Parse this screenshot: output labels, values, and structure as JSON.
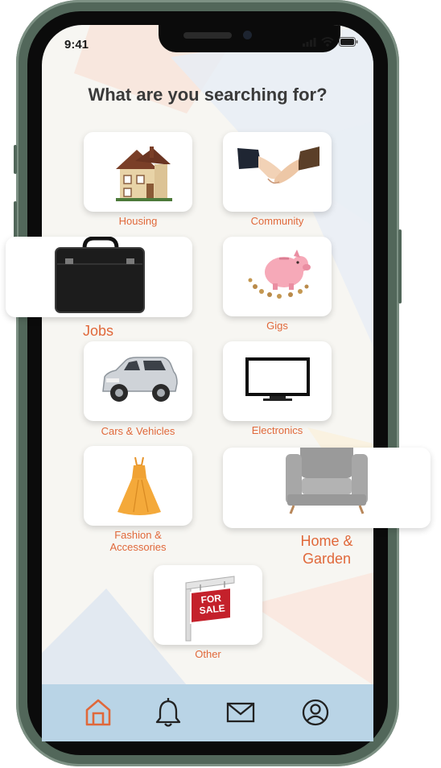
{
  "status_bar": {
    "time": "9:41"
  },
  "page": {
    "headline": "What are you searching for?"
  },
  "categories": [
    {
      "label": "Housing",
      "icon": "house-icon"
    },
    {
      "label": "Community",
      "icon": "handshake-icon"
    },
    {
      "label": "Jobs",
      "icon": "briefcase-icon"
    },
    {
      "label": "Gigs",
      "icon": "piggy-bank-icon"
    },
    {
      "label": "Cars & Vehicles",
      "icon": "car-icon"
    },
    {
      "label": "Electronics",
      "icon": "tv-icon"
    },
    {
      "label": "Fashion &",
      "label2": "Accessories",
      "icon": "dress-icon"
    },
    {
      "label": "Home &",
      "label2": "Garden",
      "icon": "armchair-icon"
    },
    {
      "label": "Other",
      "icon": "for-sale-sign-icon"
    }
  ],
  "sign_text": {
    "line1": "FOR",
    "line2": "SALE"
  },
  "nav": [
    {
      "name": "home",
      "icon": "home-icon",
      "active": true
    },
    {
      "name": "notifications",
      "icon": "bell-icon"
    },
    {
      "name": "messages",
      "icon": "mail-icon"
    },
    {
      "name": "profile",
      "icon": "user-icon"
    }
  ],
  "colors": {
    "accent": "#e0683a",
    "nav_bar": "#b9d4e6",
    "frame": "#52675a"
  }
}
